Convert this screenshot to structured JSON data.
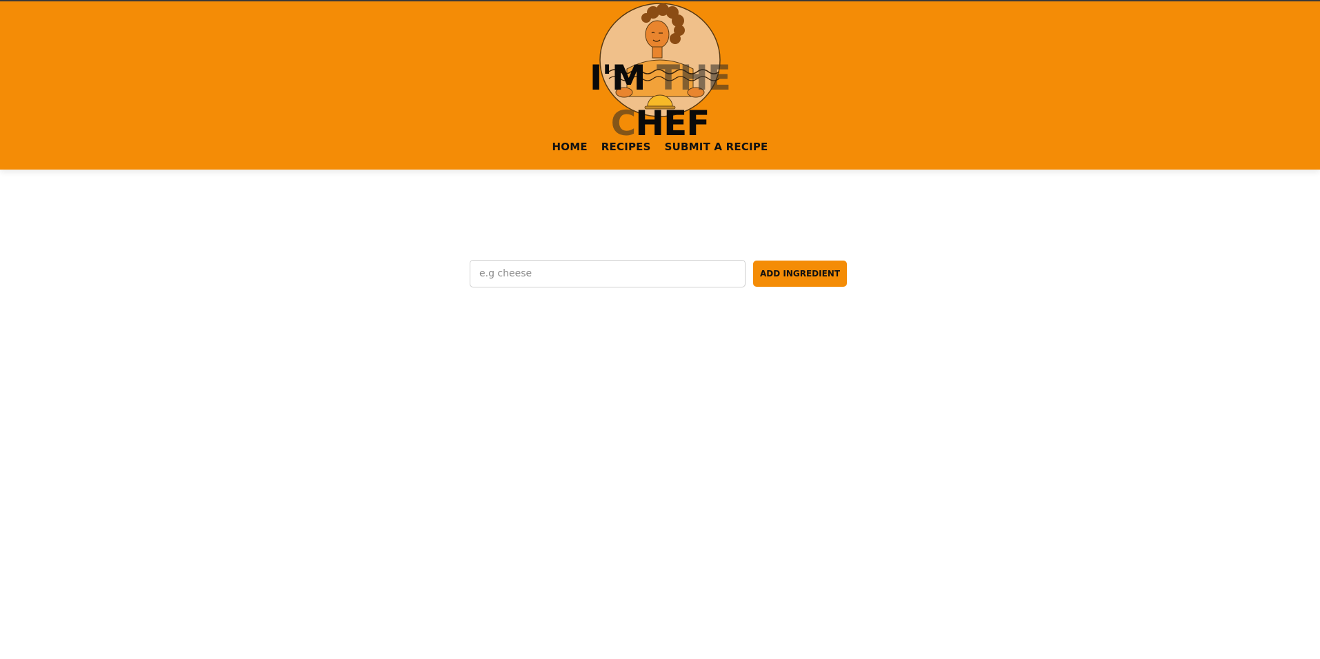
{
  "header": {
    "title_part_a": "I'M ",
    "title_part_b": "THE C",
    "title_part_c": "HEF",
    "logo_icon": "chef-girl-with-dish-illustration",
    "background_color": "#f48c06"
  },
  "nav": {
    "items": [
      {
        "label": "HOME"
      },
      {
        "label": "RECIPES"
      },
      {
        "label": "SUBMIT A RECIPE"
      }
    ]
  },
  "ingredient_form": {
    "input_value": "",
    "input_placeholder": "e.g cheese",
    "add_button_label": "ADD INGREDIENT",
    "accent_color": "#f48c06"
  }
}
